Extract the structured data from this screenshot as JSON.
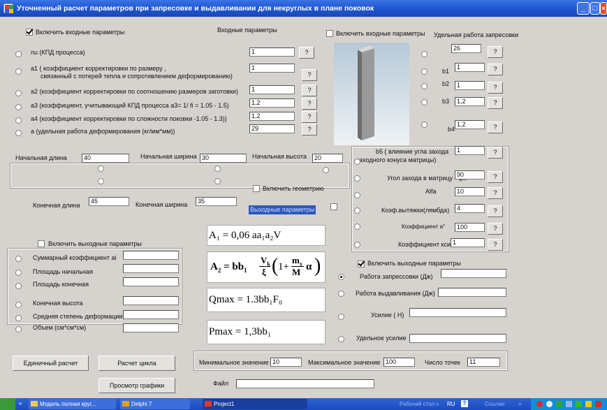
{
  "window": {
    "title": "Уточненный расчет  параметров при запресовке и выдавливании для некруглых в плане поковок"
  },
  "input_section": {
    "enable_label": "Включить входные параметры",
    "title": "Входные параметры",
    "params": [
      {
        "label": "nu    (КПД процесса)",
        "value": "1",
        "help": "?"
      },
      {
        "label": "a1    ( коэффициент корректировки по размеру ,",
        "label2": "связанный с потерей тепла и сопротивлением деформированию)",
        "value": "1",
        "help": "?"
      },
      {
        "label": "a2    (коэффициент корректировки по соотношению размеров заготовки)",
        "value": "1",
        "help": "?"
      },
      {
        "label": "a3    (коэффициент, учитывающий КПД процесса  a3= 1/ fi = 1.05 - 1.5)",
        "value": "1,2",
        "help": "?"
      },
      {
        "label": "a4    (коэффициент корректировки  по сложности поковки -1.05 - 1.3))",
        "value": "1,2",
        "help": "?"
      },
      {
        "label": "a    (удельная работа  деформирования (кг/мм*мм))",
        "value": "29",
        "help": "?"
      }
    ]
  },
  "right_input": {
    "enable_label": "Включить входные параметры",
    "title": "Удельная работа запресовки",
    "params": [
      {
        "label": "",
        "value": "26",
        "help": "?"
      },
      {
        "label": "b1",
        "value": "1",
        "help": "?"
      },
      {
        "label": "b2",
        "value": "1",
        "help": "?"
      },
      {
        "label": "b3",
        "value": "1,2",
        "help": "?"
      },
      {
        "label": "b4",
        "value": "1,2",
        "help": "?"
      }
    ],
    "b5_label": "b5 ( влияние угла захода",
    "b5_label2": "заходного конуса матрицы)",
    "b5_value": "1",
    "angle_label": "Угол захода в матрицу - фи",
    "angle_value": "90",
    "alfa_label": "Alfa",
    "alfa_value": "10",
    "lambda_label": "Коэф.вытяжки(лямбда)",
    "lambda_value": "4",
    "alpha_coef_label": "Коэффициент  а°",
    "alpha_coef_value": "100",
    "ksi_label": "Коэффициент кси",
    "ksi_value": "1",
    "help": "?"
  },
  "geometry": {
    "initial_length_label": "Начальная длина",
    "initial_length_value": "40",
    "initial_width_label": "Начальная ширина",
    "initial_width_value": "30",
    "initial_height_label": "Начальная высота",
    "initial_height_value": "20",
    "enable_geometry_label": "Включить геометрию",
    "final_length_label": "Конечная длина",
    "final_length_value": "45",
    "final_width_label": "Конечная ширина",
    "final_width_value": "35",
    "output_params_label": "Выходные параметры"
  },
  "output_section": {
    "enable_label": "Включить выходные параметры",
    "items": [
      {
        "label": "Суммарный коэффициент ai",
        "value": ""
      },
      {
        "label": "Площадь начальная",
        "value": ""
      },
      {
        "label": "Площадь конечная",
        "value": ""
      },
      {
        "label": "Конечная высота",
        "value": ""
      },
      {
        "label": "Средняя степень деформации",
        "value": ""
      },
      {
        "label": "Объем (см*см*см)",
        "value": ""
      }
    ]
  },
  "right_output": {
    "enable_label": "Включить выходные параметры",
    "items": [
      {
        "label": "Работа запрессовки (Дж)",
        "value": ""
      },
      {
        "label": "Работа выдавливания (Дж)",
        "value": ""
      },
      {
        "label": "Усилие ( Н)",
        "value": ""
      },
      {
        "label": "Удельное усилие",
        "value": ""
      }
    ]
  },
  "formulas": {
    "f1": "A₁ = 0,06 aa₁a₂V",
    "f3": "Qmax = 1.3bb₁F₀",
    "f4": "Pmax = 1,3bb₁"
  },
  "bottom": {
    "single_calc": "Единичный расчет",
    "cycle_calc": "Расчет цикла",
    "view_chart": "Просмотр графики",
    "min_label": "Минимальное значение",
    "min_value": "10",
    "max_label": "Максимальное значение",
    "max_value": "100",
    "points_label": "Число точек",
    "points_value": "11",
    "file_label": "Файл",
    "file_value": ""
  },
  "taskbar": {
    "items": [
      "Модель полная круг...",
      "Delphi 7",
      "Project1"
    ],
    "desktop": "Рабочий стол",
    "lang": "RU",
    "links": "Ссылки"
  },
  "colors": {
    "title_bar": "#1f56cf",
    "window_bg": "#d6d3ce",
    "taskbar": "#1b4cc0"
  }
}
